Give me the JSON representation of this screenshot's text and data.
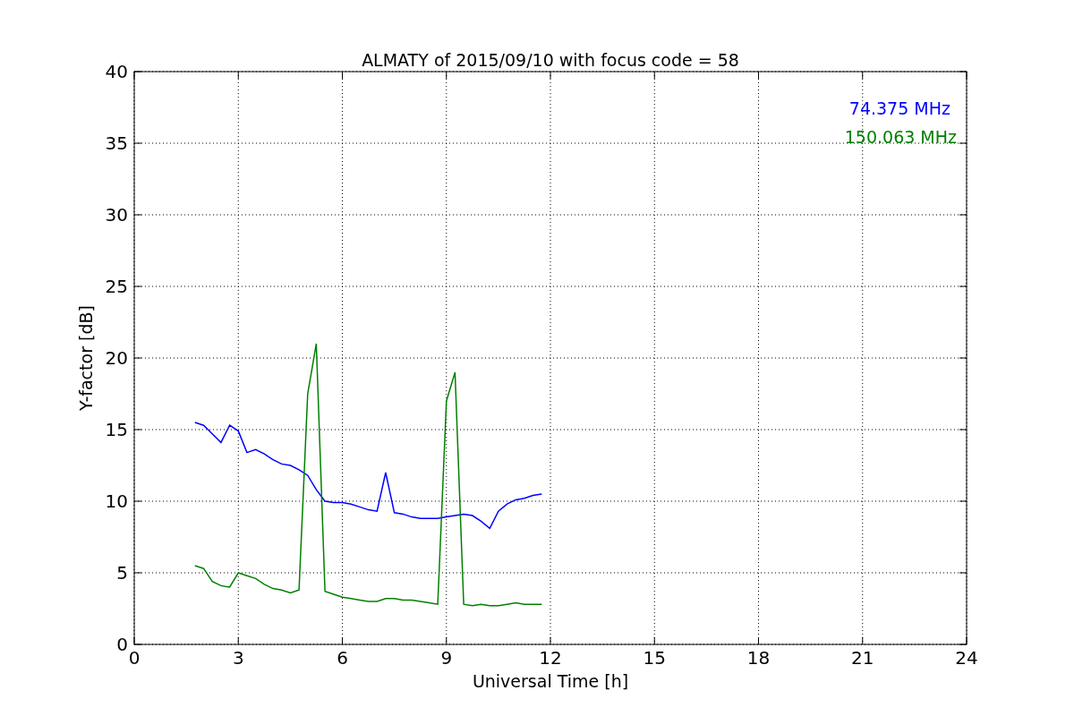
{
  "chart_data": {
    "type": "line",
    "title": "ALMATY of 2015/09/10 with focus code = 58",
    "xlabel": "Universal Time [h]",
    "ylabel": "Y-factor [dB]",
    "x": [
      1.75,
      2,
      2.25,
      2.5,
      2.75,
      3,
      3.25,
      3.5,
      3.75,
      4,
      4.25,
      4.5,
      4.75,
      5,
      5.25,
      5.5,
      5.75,
      6,
      6.25,
      6.5,
      6.75,
      7,
      7.25,
      7.5,
      7.75,
      8,
      8.25,
      8.5,
      8.75,
      9,
      9.25,
      9.5,
      9.75,
      10,
      10.25,
      10.5,
      10.75,
      11,
      11.25,
      11.5,
      11.75
    ],
    "series": [
      {
        "name": "74.375 MHz",
        "color": "#0000ff",
        "values": [
          15.5,
          15.3,
          14.7,
          14.1,
          15.3,
          14.9,
          13.4,
          13.6,
          13.3,
          12.9,
          12.6,
          12.5,
          12.2,
          11.8,
          10.8,
          10.0,
          9.9,
          9.9,
          9.8,
          9.6,
          9.4,
          9.3,
          12.0,
          9.2,
          9.1,
          8.9,
          8.8,
          8.8,
          8.8,
          8.9,
          9.0,
          9.1,
          9.0,
          8.6,
          8.1,
          9.3,
          9.8,
          10.1,
          10.2,
          10.4,
          10.5
        ]
      },
      {
        "name": "150.063 MHz",
        "color": "#008000",
        "values": [
          5.5,
          5.3,
          4.4,
          4.1,
          4.0,
          5.0,
          4.8,
          4.6,
          4.2,
          3.9,
          3.8,
          3.6,
          3.8,
          17.5,
          21.0,
          3.7,
          3.5,
          3.3,
          3.2,
          3.1,
          3.0,
          3.0,
          3.2,
          3.2,
          3.1,
          3.1,
          3.0,
          2.9,
          2.8,
          17.0,
          19.0,
          2.8,
          2.7,
          2.8,
          2.7,
          2.7,
          2.8,
          2.9,
          2.8,
          2.8,
          2.8
        ]
      }
    ],
    "xlim": [
      0,
      24
    ],
    "ylim": [
      0,
      40
    ],
    "xticks": [
      0,
      3,
      6,
      9,
      12,
      15,
      18,
      21,
      24
    ],
    "yticks": [
      0,
      5,
      10,
      15,
      20,
      25,
      30,
      35,
      40
    ],
    "grid": true
  }
}
